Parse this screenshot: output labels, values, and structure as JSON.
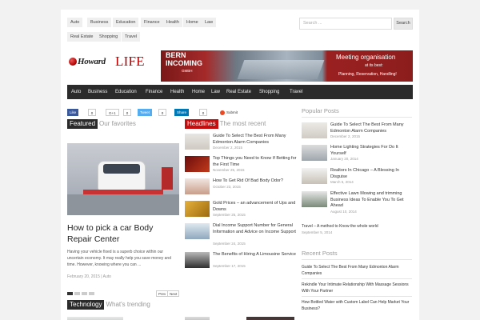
{
  "top_nav": {
    "items": [
      "Auto",
      "Business",
      "Education",
      "Finance",
      "Health",
      "Home",
      "Law",
      "Real Estate",
      "Shopping",
      "Travel"
    ]
  },
  "search": {
    "placeholder": "Search ...",
    "button": "Search"
  },
  "logo": {
    "part1": "Howard",
    "part2": "LIFE"
  },
  "banner": {
    "line1": "BERN",
    "line2": "INCOMING",
    "company": "GMBH",
    "headline": "Meeting organisation",
    "sub": "at its best:",
    "tagline": "Planning, Reservation, Handling!"
  },
  "main_nav": {
    "items": [
      "Auto",
      "Business",
      "Education",
      "Finance",
      "Health",
      "Home",
      "Law",
      "Real Estate",
      "Shopping",
      "Travel"
    ]
  },
  "share": {
    "like": "Like",
    "like_count": "0",
    "gplus": "G+1",
    "gplus_count": "0",
    "tweet": "Tweet",
    "tweet_count": "0",
    "linkedin": "Share",
    "linkedin_count": "0",
    "submit": "Submit"
  },
  "featured": {
    "tag": "Featured",
    "sub": "Our favorites",
    "title": "How to pick a car Body Repair Center",
    "excerpt": "Having your vehicle fixed is a superb choice within our uncertain economy. It may really help you save money and time. However, knowing where you can ...",
    "date": "February 20, 2015",
    "category": "Auto",
    "prev": "Prev",
    "next": "Next"
  },
  "headlines": {
    "tag": "Headlines",
    "sub": "The most recent",
    "items": [
      {
        "title": "Guide To Select The Best From Many Edmonton Alarm Companies",
        "date": "December 2, 2015"
      },
      {
        "title": "Top Things you Need to Know If Betting for the First Time",
        "date": "November 25, 2015"
      },
      {
        "title": "How To Get Rid Of Bad Body Odor?",
        "date": "October 23, 2015"
      },
      {
        "title": "Gold Prices – an advancement of Ups and Downs",
        "date": "September 25, 2015"
      },
      {
        "title": "Dial Income Support Number for General Information and Advice on Income Support",
        "date": "September 24, 2015"
      },
      {
        "title": "The Benefits of Hiring A Limousine Service",
        "date": "September 17, 2015"
      }
    ]
  },
  "popular": {
    "heading": "Popular Posts",
    "items": [
      {
        "title": "Guide To Select The Best From Many Edmonton Alarm Companies",
        "date": "December 2, 2015"
      },
      {
        "title": "Home Lighting Strategies For Do It Yourself",
        "date": "January 20, 2014"
      },
      {
        "title": "Realtors In Chicago – A Blessing In Disguise",
        "date": "March 5, 2014"
      },
      {
        "title": "Effective Lawn Mowing and trimming Business Ideas To Enable You To Get Ahead",
        "date": "August 10, 2014"
      }
    ],
    "last_title": "Travel – A method to Know the whole world",
    "last_date": "September 5, 2014"
  },
  "recent": {
    "heading": "Recent Posts",
    "items": [
      "Guide To Select The Best From Many Edmonton Alarm Companies",
      "Rekindle Your Intimate Relationship With Massage Sessions With Your Partner",
      "How Bottled Water with Custom Label Can Help Market Your Business?"
    ]
  },
  "technology": {
    "tag": "Technology",
    "sub": "What's trending"
  },
  "colors": {
    "nav_bg": "#2b2b2b",
    "accent_red": "#c60c0c",
    "facebook": "#3b5998",
    "twitter": "#55acee",
    "linkedin": "#0077b5"
  }
}
